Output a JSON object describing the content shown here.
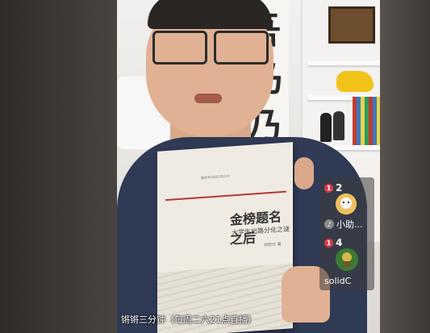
{
  "caption": {
    "text": "锵锵三分钟（每周二六21点直播）"
  },
  "book": {
    "series": "教育考试研究院丛书",
    "title": "金榜题名之后",
    "subtitle": "大学生出路分化之谜",
    "authors": "郑若玲 著"
  },
  "sidebar": {
    "items": [
      {
        "rank": "1",
        "count": "2"
      },
      {
        "name": "小助..."
      },
      {
        "rank": "1",
        "count": "4"
      },
      {
        "name": "solidC"
      }
    ]
  },
  "colors": {
    "badge": "#d93a4a",
    "panel": "rgba(60,60,60,0.55)"
  }
}
